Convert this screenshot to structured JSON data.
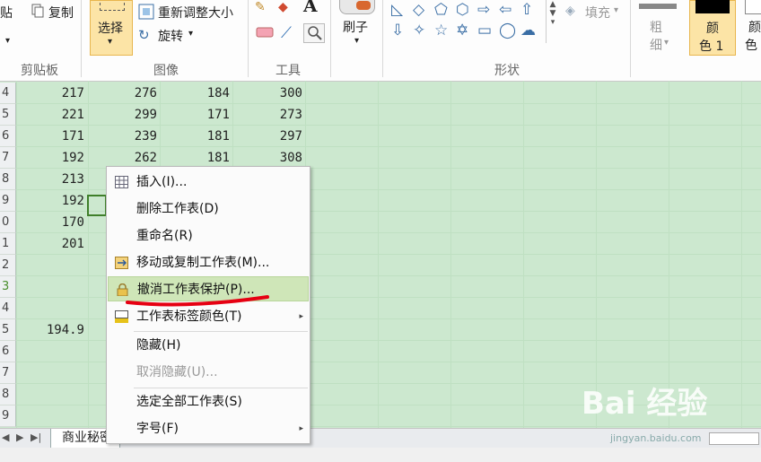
{
  "ribbon": {
    "clipboard": {
      "paste_label": "贴",
      "copy_label": "复制",
      "group_label": "剪贴板"
    },
    "image": {
      "select_label": "选择",
      "resize_label": "重新调整大小",
      "rotate_label": "旋转",
      "group_label": "图像"
    },
    "tools": {
      "group_label": "工具"
    },
    "brush": {
      "label": "刷子"
    },
    "shapes": {
      "group_label": "形状",
      "fill_label": "填充"
    },
    "size": {
      "label_line1": "粗",
      "label_line2": "细"
    },
    "color1": {
      "line1": "颜",
      "line2": "色 1"
    },
    "color2": {
      "line1": "颜",
      "line2": "色"
    }
  },
  "rows": [
    {
      "num": "4",
      "cells": [
        "217",
        "276",
        "184",
        "300"
      ]
    },
    {
      "num": "5",
      "cells": [
        "221",
        "299",
        "171",
        "273"
      ]
    },
    {
      "num": "6",
      "cells": [
        "171",
        "239",
        "181",
        "297"
      ]
    },
    {
      "num": "7",
      "cells": [
        "192",
        "262",
        "181",
        "308"
      ]
    },
    {
      "num": "8",
      "cells": [
        "213",
        "",
        "",
        " "
      ]
    },
    {
      "num": "9",
      "cells": [
        "192",
        "",
        "",
        ""
      ]
    },
    {
      "num": "0",
      "cells": [
        "170",
        "",
        "",
        ""
      ]
    },
    {
      "num": "1",
      "cells": [
        "201",
        "",
        "",
        ""
      ]
    },
    {
      "num": "2",
      "cells": [
        "",
        "",
        "",
        ""
      ]
    },
    {
      "num": "3",
      "cells": [
        "",
        "",
        "",
        ""
      ]
    },
    {
      "num": "4",
      "cells": [
        "",
        "",
        "",
        ""
      ]
    },
    {
      "num": "5",
      "cells": [
        "194.9",
        "",
        "",
        ""
      ]
    },
    {
      "num": "6",
      "cells": [
        "",
        "",
        "",
        ""
      ]
    },
    {
      "num": "7",
      "cells": [
        "",
        "",
        "",
        ""
      ]
    },
    {
      "num": "8",
      "cells": [
        "",
        "",
        "",
        ""
      ]
    },
    {
      "num": "9",
      "cells": [
        "",
        "",
        "",
        ""
      ]
    }
  ],
  "sheet_tab": {
    "label": "商业秘密"
  },
  "context_menu": {
    "items": [
      {
        "label": "插入(I)...",
        "icon": "table-icon"
      },
      {
        "label": "删除工作表(D)"
      },
      {
        "label": "重命名(R)"
      },
      {
        "label": "移动或复制工作表(M)...",
        "icon": "move-sheet-icon"
      },
      {
        "label": "撤消工作表保护(P)...",
        "icon": "lock-icon",
        "highlighted": true
      },
      {
        "label": "工作表标签颜色(T)",
        "icon": "tab-color-icon",
        "submenu": true
      },
      {
        "label": "隐藏(H)"
      },
      {
        "label": "取消隐藏(U)...",
        "disabled": true
      },
      {
        "label": "选定全部工作表(S)"
      },
      {
        "label": "字号(F)",
        "submenu": true
      }
    ]
  },
  "watermark": {
    "main": "Bai 经验",
    "sub": "jingyan.baidu.com"
  },
  "colors": {
    "sheet_bg": "#cce8cf",
    "highlight": "#cfe6b8",
    "annotation": "#e60012"
  }
}
